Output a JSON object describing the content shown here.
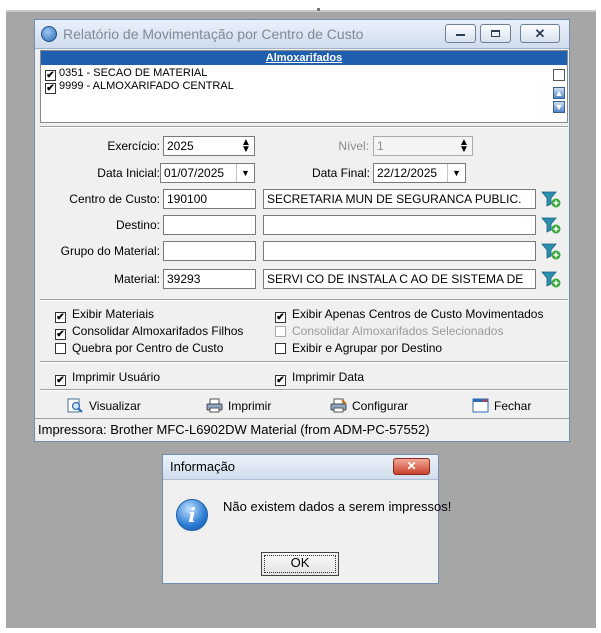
{
  "window": {
    "title": "Relatório de Movimentação por Centro de Custo",
    "minimize_glyph": "",
    "close_glyph": "✕"
  },
  "warehouses": {
    "header": "Almoxarifados",
    "items": [
      {
        "label": "0351 - SECAO DE MATERIAL",
        "checked": true
      },
      {
        "label": "9999 - ALMOXARIFADO CENTRAL",
        "checked": true
      }
    ],
    "select_all_checked": false,
    "up_glyph": "▲",
    "down_glyph": "▼"
  },
  "filters": {
    "exercicio_label": "Exercício:",
    "exercicio_value": "2025",
    "nivel_label": "Nível:",
    "nivel_value": "1",
    "data_inicial_label": "Data Inicial:",
    "data_inicial_value": "01/07/2025",
    "data_final_label": "Data Final:",
    "data_final_value": "22/12/2025",
    "centro_custo_label": "Centro de Custo:",
    "centro_custo_code": "190100",
    "centro_custo_desc": "SECRETARIA MUN DE SEGURANCA PUBLIC.",
    "destino_label": "Destino:",
    "destino_code": "",
    "destino_desc": "",
    "grupo_label": "Grupo do Material:",
    "grupo_code": "",
    "grupo_desc": "",
    "material_label": "Material:",
    "material_code": "39293",
    "material_desc": "SERVI CO DE INSTALA C AO DE SISTEMA DE",
    "spin_glyph": "⬍",
    "drop_glyph": "▼"
  },
  "options": {
    "exibir_materiais": "Exibir Materiais",
    "consolidar_filhos": "Consolidar Almoxarifados Filhos",
    "quebra_centro": "Quebra por Centro de Custo",
    "exibir_apenas_centros": "Exibir Apenas Centros de Custo Movimentados",
    "consolidar_selecionados": "Consolidar Almoxarifados Selecionados",
    "exibir_agrupar_destino": "Exibir e Agrupar por Destino",
    "imprimir_usuario": "Imprimir Usuário",
    "imprimir_data": "Imprimir Data",
    "check_glyph": "✔"
  },
  "actions": {
    "visualizar": "Visualizar",
    "imprimir": "Imprimir",
    "configurar": "Configurar",
    "fechar": "Fechar"
  },
  "status": {
    "printer": "Impressora: Brother MFC-L6902DW Material (from ADM-PC-57552)"
  },
  "dialog": {
    "title": "Informação",
    "message": "Não existem dados a serem impressos!",
    "ok_label": "OK",
    "close_glyph": "✕",
    "icon_glyph": "i"
  },
  "colors": {
    "header_blue": "#1f5fb0",
    "filter_teal": "#2a8fb0",
    "filter_plus": "#3aa73a"
  }
}
